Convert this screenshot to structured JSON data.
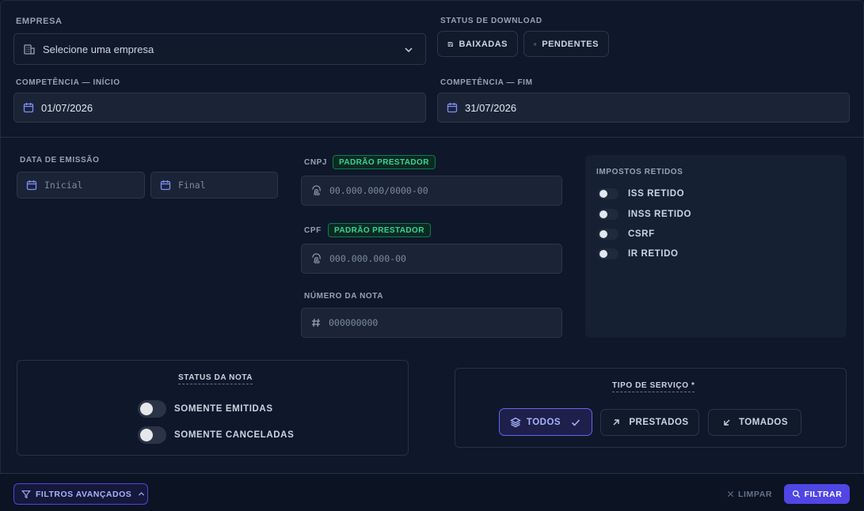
{
  "empresa": {
    "label": "EMPRESA",
    "placeholder": "Selecione uma empresa"
  },
  "download_status": {
    "label": "STATUS DE DOWNLOAD",
    "baixadas": "BAIXADAS",
    "pendentes": "PENDENTES"
  },
  "competencia_inicio": {
    "label": "COMPETÊNCIA — INÍCIO",
    "value": "01/07/2026"
  },
  "competencia_fim": {
    "label": "COMPETÊNCIA — FIM",
    "value": "31/07/2026"
  },
  "data_emissao": {
    "label": "DATA DE EMISSÃO",
    "inicial": "Inicial",
    "final": "Final"
  },
  "cnpj": {
    "label": "CNPJ",
    "badge": "PADRÃO PRESTADOR",
    "placeholder": "00.000.000/0000-00"
  },
  "cpf": {
    "label": "CPF",
    "badge": "PADRÃO PRESTADOR",
    "placeholder": "000.000.000-00"
  },
  "numero_nota": {
    "label": "NÚMERO DA NOTA",
    "placeholder": "000000000"
  },
  "impostos": {
    "title": "IMPOSTOS RETIDOS",
    "items": [
      "ISS RETIDO",
      "INSS RETIDO",
      "CSRF",
      "IR RETIDO"
    ]
  },
  "status_nota": {
    "title": "STATUS DA NOTA",
    "emitidas": "SOMENTE EMITIDAS",
    "canceladas": "SOMENTE CANCELADAS"
  },
  "tipo_servico": {
    "title": "TIPO DE SERVIÇO *",
    "todos": "TODOS",
    "prestados": "PRESTADOS",
    "tomados": "TOMADOS"
  },
  "footer": {
    "filtros": "FILTROS AVANÇADOS",
    "limpar": "LIMPAR",
    "filtrar": "FILTRAR"
  },
  "colors": {
    "accent": "#4f46e5",
    "accent_light": "#818cf8",
    "success": "#34d399",
    "bg": "#0f172a"
  }
}
